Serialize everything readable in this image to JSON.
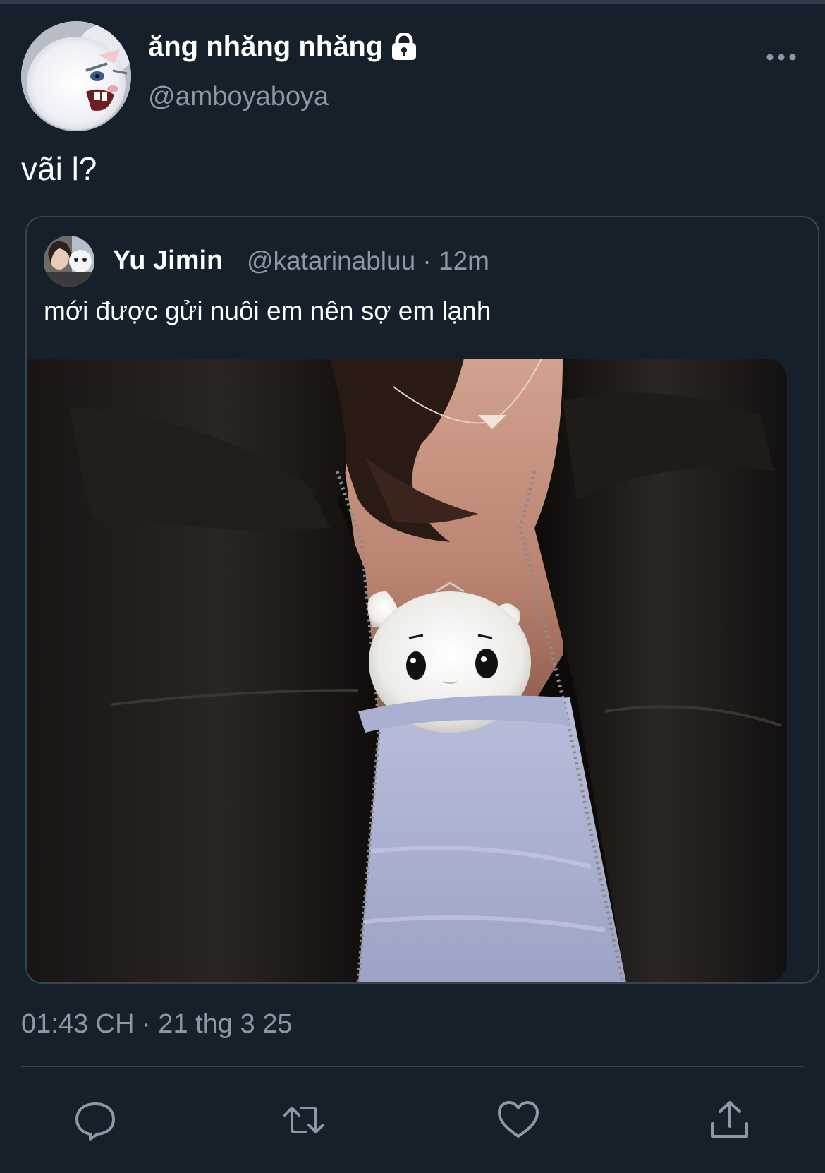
{
  "tweet": {
    "author": {
      "display_name": "ăng nhăng nhăng",
      "handle": "@amboyaboya",
      "protected_icon": "lock-icon",
      "avatar_desc": "angry-white-bunny-avatar"
    },
    "text": "vãi l?",
    "menu_icon": "more-dots-icon",
    "timestamp": "01:43 CH · 21 thg 3 25"
  },
  "quote": {
    "author": {
      "display_name": "Yu Jimin",
      "handle_time": "@katarinabluu · 12m"
    },
    "text": "mới được gửi nuôi em nên sợ em lạnh"
  },
  "actions": {
    "reply_icon": "reply-icon",
    "retweet_icon": "retweet-icon",
    "like_icon": "heart-icon",
    "share_icon": "share-icon"
  },
  "colors": {
    "background": "#15202b",
    "secondary_text": "#8b98a5",
    "border": "#38444d"
  }
}
